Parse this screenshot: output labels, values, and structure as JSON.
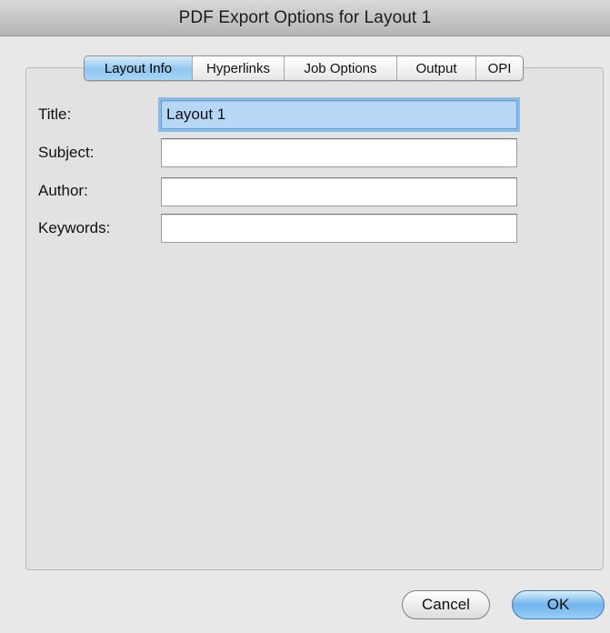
{
  "window": {
    "title": "PDF Export Options for Layout 1"
  },
  "tabs": [
    {
      "label": "Layout Info",
      "selected": true
    },
    {
      "label": "Hyperlinks",
      "selected": false
    },
    {
      "label": "Job Options",
      "selected": false
    },
    {
      "label": "Output",
      "selected": false
    },
    {
      "label": "OPI",
      "selected": false
    }
  ],
  "form": {
    "title_label": "Title:",
    "title_value": "Layout 1",
    "subject_label": "Subject:",
    "subject_value": "",
    "author_label": "Author:",
    "author_value": "",
    "keywords_label": "Keywords:",
    "keywords_value": ""
  },
  "buttons": {
    "cancel_label": "Cancel",
    "ok_label": "OK"
  },
  "colors": {
    "selection_blue": "#8fc6f2",
    "focus_ring": "#8bbbe9",
    "default_button": "#6fb4ee"
  }
}
